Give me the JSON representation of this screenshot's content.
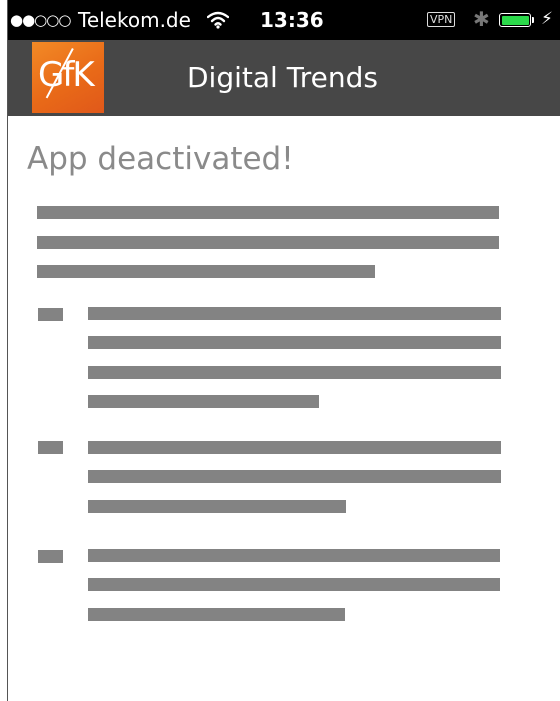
{
  "status_bar": {
    "signal": "●●○○○",
    "carrier": "Telekom.de",
    "time": "13:36",
    "vpn": "VPN",
    "bluetooth": "✱",
    "charging": "⚡",
    "battery_level": 1.0,
    "battery_color": "#2bd94a"
  },
  "header": {
    "logo_text": "GfK",
    "title": "Digital Trends",
    "background": "#474747",
    "logo_color": "#e96a18"
  },
  "main": {
    "title": "App deactivated!",
    "redaction_color": "#838383"
  }
}
